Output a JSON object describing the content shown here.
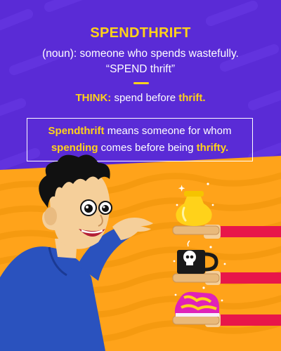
{
  "title": "SPENDTHRIFT",
  "definition": {
    "line1": "(noun): someone who spends wastefully.",
    "line2": "“SPEND thrift”"
  },
  "think": {
    "prefix": "THINK:",
    "word1": "spend",
    "middle": "before",
    "word2": "thrift."
  },
  "explanation": {
    "word1": "Spendthrift",
    "text1": "means someone for whom",
    "word2": "spending",
    "text2": "comes before being",
    "word3": "thrifty."
  },
  "colors": {
    "background_purple": "#5a2bd6",
    "background_orange": "#ffa31a",
    "accent_yellow": "#ffd21a",
    "shirt_blue": "#2a52be",
    "arm_red": "#e8164a"
  },
  "illustration": {
    "character": "man reaching toward shelves",
    "items": [
      "gold-vase-icon",
      "skull-mug-icon",
      "pink-sneaker-icon"
    ]
  }
}
